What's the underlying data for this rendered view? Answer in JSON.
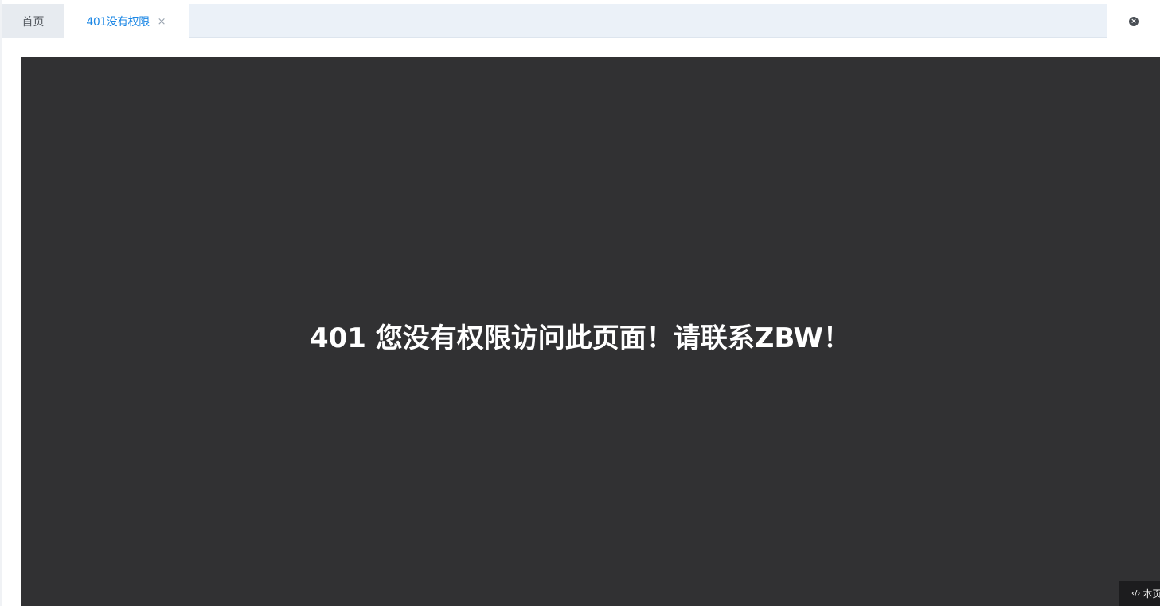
{
  "tabs": [
    {
      "label": "首页"
    },
    {
      "label": "401没有权限",
      "close": "×"
    }
  ],
  "close_all_icon": "×",
  "message": "401 您没有权限访问此页面！请联系ZBW！",
  "corner_button": {
    "icon": "‹/›",
    "label": "本页"
  },
  "colors": {
    "accent": "#1e88e5",
    "content_bg": "#313133",
    "tabbar_bg": "#ebf1f8"
  }
}
